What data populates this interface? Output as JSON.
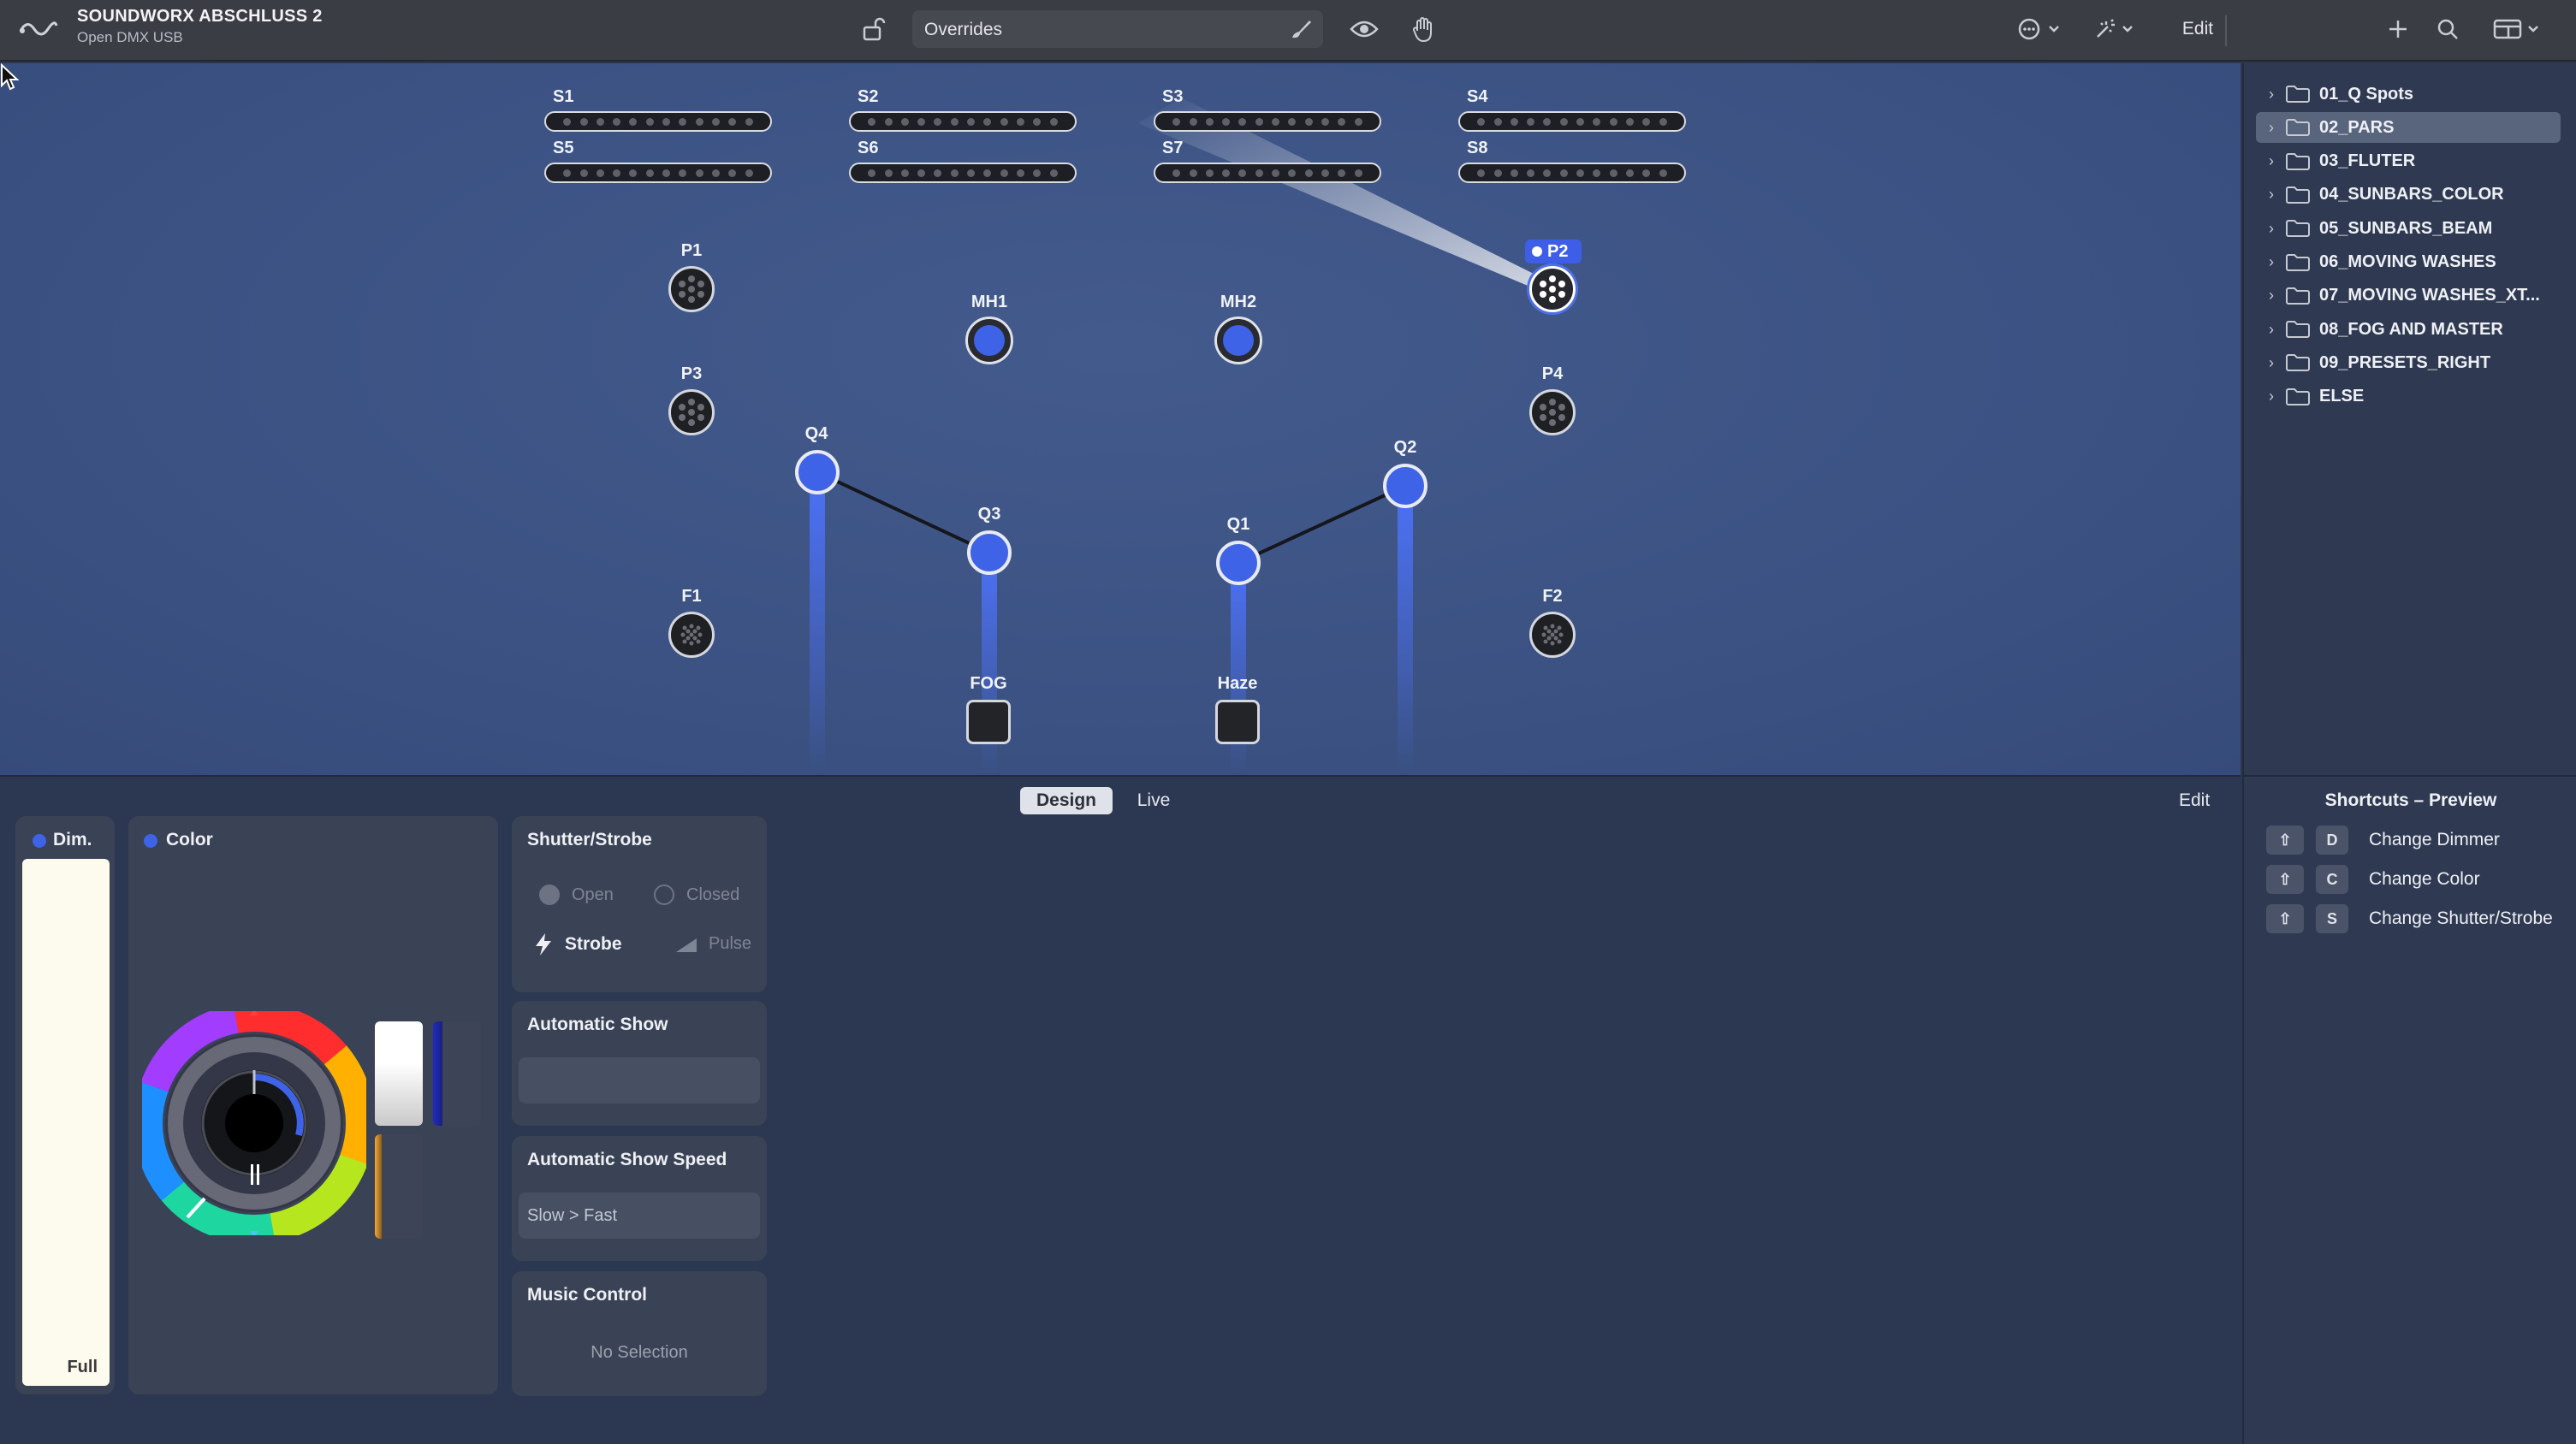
{
  "toolbar": {
    "title": "SOUNDWORX ABSCHLUSS 2",
    "subtitle": "Open DMX USB",
    "overrides_label": "Overrides",
    "edit_label": "Edit"
  },
  "stage": {
    "bar_fixtures": [
      "S1",
      "S2",
      "S3",
      "S4",
      "S5",
      "S6",
      "S7",
      "S8"
    ],
    "pars": [
      "P1",
      "P2",
      "P3",
      "P4"
    ],
    "movers": [
      "MH1",
      "MH2"
    ],
    "spots": [
      "Q1",
      "Q2",
      "Q3",
      "Q4"
    ],
    "fx": [
      "F1",
      "F2"
    ],
    "atmos": [
      "FOG",
      "Haze"
    ],
    "selected_fixture": "P2"
  },
  "sidebar": {
    "items": [
      {
        "label": "01_Q Spots",
        "selected": false
      },
      {
        "label": "02_PARS",
        "selected": true
      },
      {
        "label": "03_FLUTER",
        "selected": false
      },
      {
        "label": "04_SUNBARS_COLOR",
        "selected": false
      },
      {
        "label": "05_SUNBARS_BEAM",
        "selected": false
      },
      {
        "label": "06_MOVING WASHES",
        "selected": false
      },
      {
        "label": "07_MOVING WASHES_XT...",
        "selected": false
      },
      {
        "label": "08_FOG AND MASTER",
        "selected": false
      },
      {
        "label": "09_PRESETS_RIGHT",
        "selected": false
      },
      {
        "label": "ELSE",
        "selected": false
      }
    ]
  },
  "bottom": {
    "tabs": {
      "design": "Design",
      "live": "Live"
    },
    "edit_label": "Edit",
    "dimmer": {
      "title": "Dim.",
      "value_label": "Full",
      "level": 1.0
    },
    "color": {
      "title": "Color"
    },
    "shutter": {
      "title": "Shutter/Strobe",
      "open": "Open",
      "closed": "Closed",
      "strobe": "Strobe",
      "pulse": "Pulse"
    },
    "auto_show": {
      "title": "Automatic Show",
      "value": ""
    },
    "auto_speed": {
      "title": "Automatic Show Speed",
      "value": "Slow > Fast"
    },
    "music": {
      "title": "Music Control",
      "value": "No Selection"
    }
  },
  "shortcuts": {
    "title": "Shortcuts – Preview",
    "items": [
      {
        "key": "D",
        "label": "Change Dimmer"
      },
      {
        "key": "C",
        "label": "Change Color"
      },
      {
        "key": "S",
        "label": "Change Shutter/Strobe"
      }
    ]
  },
  "colors": {
    "accent": "#3e63e6",
    "stage": "#3b5283",
    "panel": "#3a4255"
  }
}
